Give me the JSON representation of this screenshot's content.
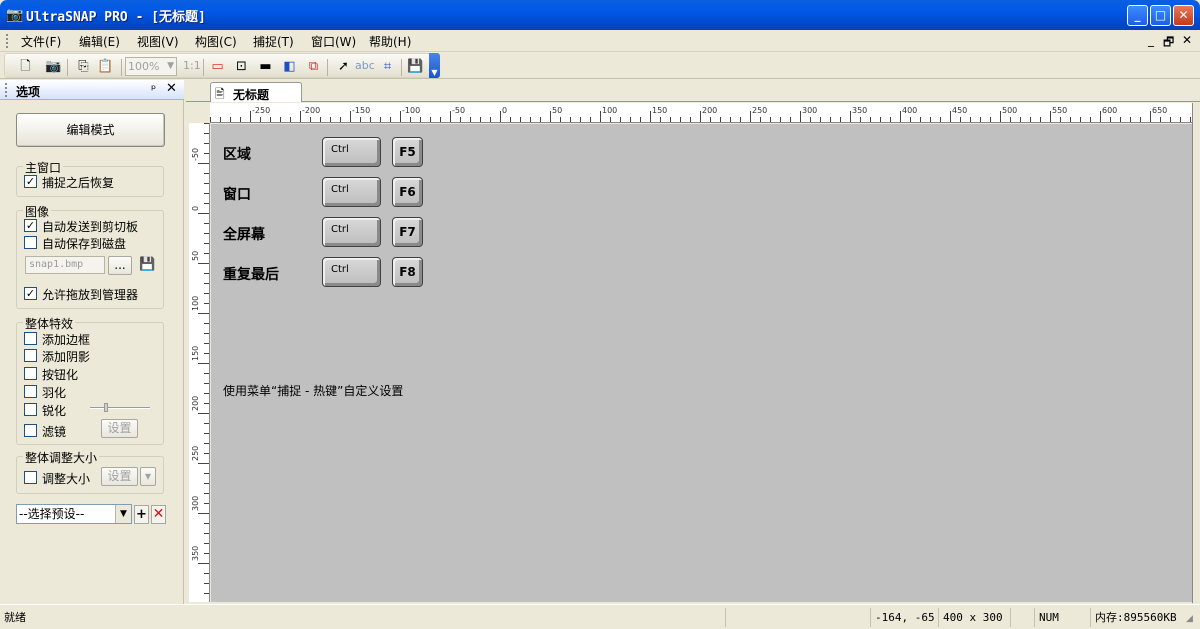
{
  "titlebar": {
    "title": "UltraSNAP PRO - [无标题]",
    "minimize_label": "_",
    "maximize_label": "□",
    "close_label": "✕"
  },
  "menubar": {
    "items": [
      "文件(F)",
      "编辑(E)",
      "视图(V)",
      "构图(C)",
      "捕捉(T)",
      "窗口(W)",
      "帮助(H)"
    ],
    "mdi_buttons": [
      "_",
      "🗗",
      "✕"
    ]
  },
  "toolbar": {
    "zoom_value": "100%",
    "ratio_label": "1:1",
    "abc_label": "abc"
  },
  "panel": {
    "title": "选项",
    "edit_mode_button": "编辑模式",
    "main_window_group": {
      "legend": "主窗口",
      "restore_after_capture": {
        "label": "捕捉之后恢复",
        "checked": true
      }
    },
    "image_group": {
      "legend": "图像",
      "auto_send_clipboard": {
        "label": "自动发送到剪切板",
        "checked": true
      },
      "auto_save_disk": {
        "label": "自动保存到磁盘",
        "checked": false
      },
      "filename_placeholder": "snap1.bmp",
      "browse_button": "...",
      "allow_drag_manager": {
        "label": "允许拖放到管理器",
        "checked": true
      }
    },
    "effects_group": {
      "legend": "整体特效",
      "items": [
        {
          "label": "添加边框",
          "checked": false
        },
        {
          "label": "添加阴影",
          "checked": false
        },
        {
          "label": "按钮化",
          "checked": false
        },
        {
          "label": "羽化",
          "checked": false
        },
        {
          "label": "锐化",
          "checked": false
        },
        {
          "label": "滤镜",
          "checked": false
        }
      ],
      "filter_settings_button": "设置"
    },
    "resize_group": {
      "legend": "整体调整大小",
      "resize": {
        "label": "调整大小",
        "checked": false
      },
      "settings_button": "设置",
      "dropdown_arrow": "▾"
    },
    "preset_select": "--选择预设--",
    "add_preset": "+",
    "remove_preset": "✕"
  },
  "document": {
    "tab_label": "无标题",
    "hruler_labels": [
      "-250",
      "-200",
      "-150",
      "-100",
      "-50",
      "0",
      "50",
      "100",
      "150",
      "200",
      "250",
      "300",
      "350",
      "400",
      "450",
      "500",
      "550",
      "600",
      "650"
    ],
    "vruler_labels": [
      "-50",
      "0",
      "50",
      "100",
      "150",
      "200",
      "250",
      "300",
      "350"
    ],
    "hotkeys": [
      {
        "label": "区域",
        "modifier": "Ctrl",
        "key": "F5"
      },
      {
        "label": "窗口",
        "modifier": "Ctrl",
        "key": "F6"
      },
      {
        "label": "全屏幕",
        "modifier": "Ctrl",
        "key": "F7"
      },
      {
        "label": "重复最后",
        "modifier": "Ctrl",
        "key": "F8"
      }
    ],
    "hint": "使用菜单“捕捉 - 热键”自定义设置"
  },
  "statusbar": {
    "status": "就绪",
    "coords": "-164, -65",
    "size": "400 x 300",
    "num": "NUM",
    "memory": "内存:895560KB"
  },
  "colors": {
    "titlebar_blue": "#0058e6",
    "canvas_gray": "#c0c0c0",
    "chrome": "#ece9d8",
    "remove_red": "#e01010"
  }
}
